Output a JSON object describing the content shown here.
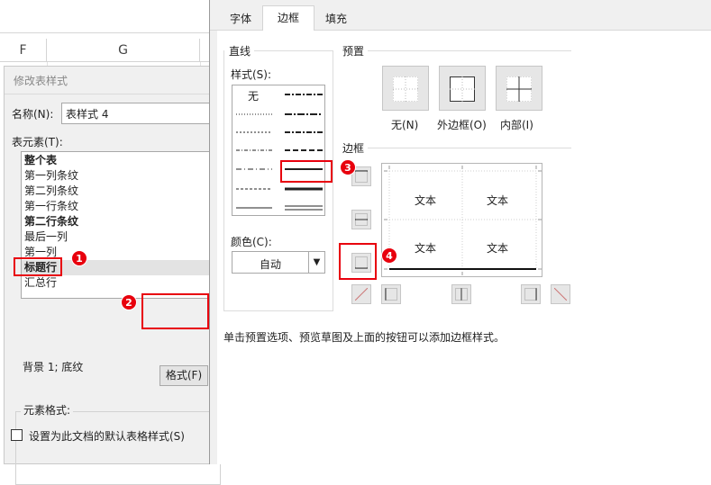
{
  "excel": {
    "columns": [
      "F",
      "G"
    ]
  },
  "modify_dialog": {
    "title": "修改表样式",
    "name_label": "名称(N):",
    "name_value": "表样式 4",
    "elements_label": "表元素(T):",
    "elements": [
      {
        "label": "整个表",
        "bold": true
      },
      {
        "label": "第一列条纹",
        "bold": false
      },
      {
        "label": "第二列条纹",
        "bold": false
      },
      {
        "label": "第一行条纹",
        "bold": false
      },
      {
        "label": "第二行条纹",
        "bold": true
      },
      {
        "label": "最后一列",
        "bold": false
      },
      {
        "label": "第一列",
        "bold": false
      },
      {
        "label": "标题行",
        "bold": true
      },
      {
        "label": "汇总行",
        "bold": false
      }
    ],
    "format_button": "格式(F)",
    "element_format_label": "元素格式:",
    "element_format_value": "背景 1; 底纹",
    "default_checkbox": "设置为此文档的默认表格样式(S)"
  },
  "format_dialog": {
    "tabs": [
      "字体",
      "边框",
      "填充"
    ],
    "active_tab": "边框",
    "line_section": "直线",
    "style_label": "样式(S):",
    "style_none": "无",
    "color_label": "颜色(C):",
    "color_value": "自动",
    "preset_section": "预置",
    "presets": [
      "无(N)",
      "外边框(O)",
      "内部(I)"
    ],
    "border_section": "边框",
    "preview_text": [
      "文本",
      "文本",
      "文本",
      "文本"
    ],
    "hint": "单击预置选项、预览草图及上面的按钮可以添加边框样式。"
  },
  "annotations": [
    "1",
    "2",
    "3",
    "4"
  ],
  "colors": {
    "annotation": "#e8000d",
    "dialog_bg": "#f0f0f0",
    "selection": "#e3e3e3"
  }
}
